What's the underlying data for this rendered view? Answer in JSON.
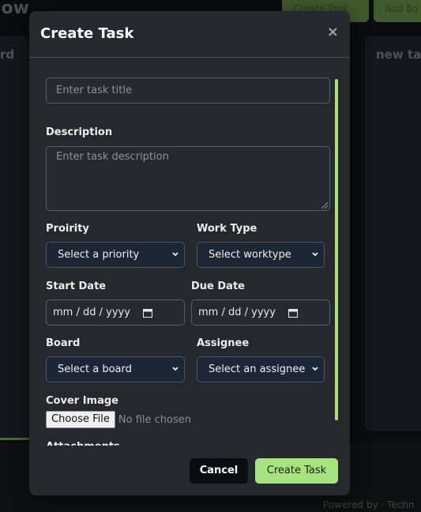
{
  "background": {
    "title_fragment": "low",
    "buttons": [
      "Create Task",
      "Add Bo"
    ],
    "column_left_title": "rd",
    "column_right_title": "new ta",
    "footer_text": "Powered by · Techn"
  },
  "modal": {
    "title": "Create Task",
    "close_symbol": "×",
    "title_placeholder": "Enter task title",
    "description_label": "Description",
    "description_placeholder": "Enter task description",
    "priority_label": "Proirity",
    "priority_value": "Select a priority",
    "worktype_label": "Work Type",
    "worktype_value": "Select worktype",
    "start_date_label": "Start Date",
    "start_date_value": "mm / dd / yyyy",
    "due_date_label": "Due Date",
    "due_date_value": "mm / dd / yyyy",
    "board_label": "Board",
    "board_value": "Select a board",
    "assignee_label": "Assignee",
    "assignee_value": "Select an assignee",
    "cover_image_label": "Cover Image",
    "choose_file_label": "Choose File",
    "no_file_text": "No file chosen",
    "attachments_label": "Attachments",
    "cancel_label": "Cancel",
    "create_label": "Create Task"
  },
  "colors": {
    "accent": "#a7e37f",
    "modal_bg": "#25282d",
    "select_bg": "#1c2634"
  }
}
